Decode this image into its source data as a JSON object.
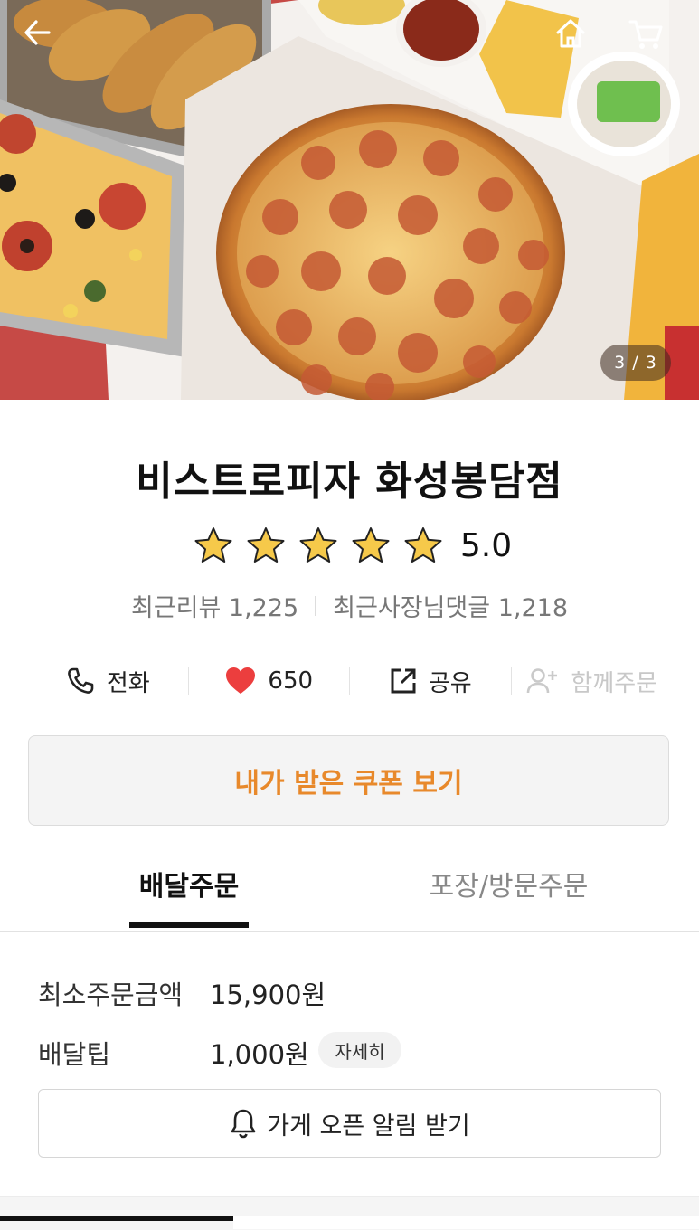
{
  "hero": {
    "image_description": "",
    "counter": "3 / 3"
  },
  "nav": {
    "back_icon": "arrow-left-icon",
    "home_icon": "home-icon",
    "cart_icon": "cart-icon"
  },
  "store": {
    "name": "비스트로피자 화성봉담점",
    "rating": "5.0",
    "stars_filled": 5,
    "recent_reviews_label": "최근리뷰 1,225",
    "owner_replies_label": "최근사장님댓글 1,218"
  },
  "actions": {
    "call": "전화",
    "likes": "650",
    "share": "공유",
    "group_order": "함께주문"
  },
  "coupon": {
    "label": "내가 받은 쿠폰 보기",
    "color": "#e8892b"
  },
  "tabs": {
    "delivery": "배달주문",
    "pickup": "포장/방문주문"
  },
  "order_info": {
    "min_order_label": "최소주문금액",
    "min_order_value": "15,900원",
    "delivery_tip_label": "배달팁",
    "delivery_tip_value": "1,000원",
    "detail_chip": "자세히"
  },
  "notify": {
    "label": "가게 오픈 알림 받기"
  }
}
